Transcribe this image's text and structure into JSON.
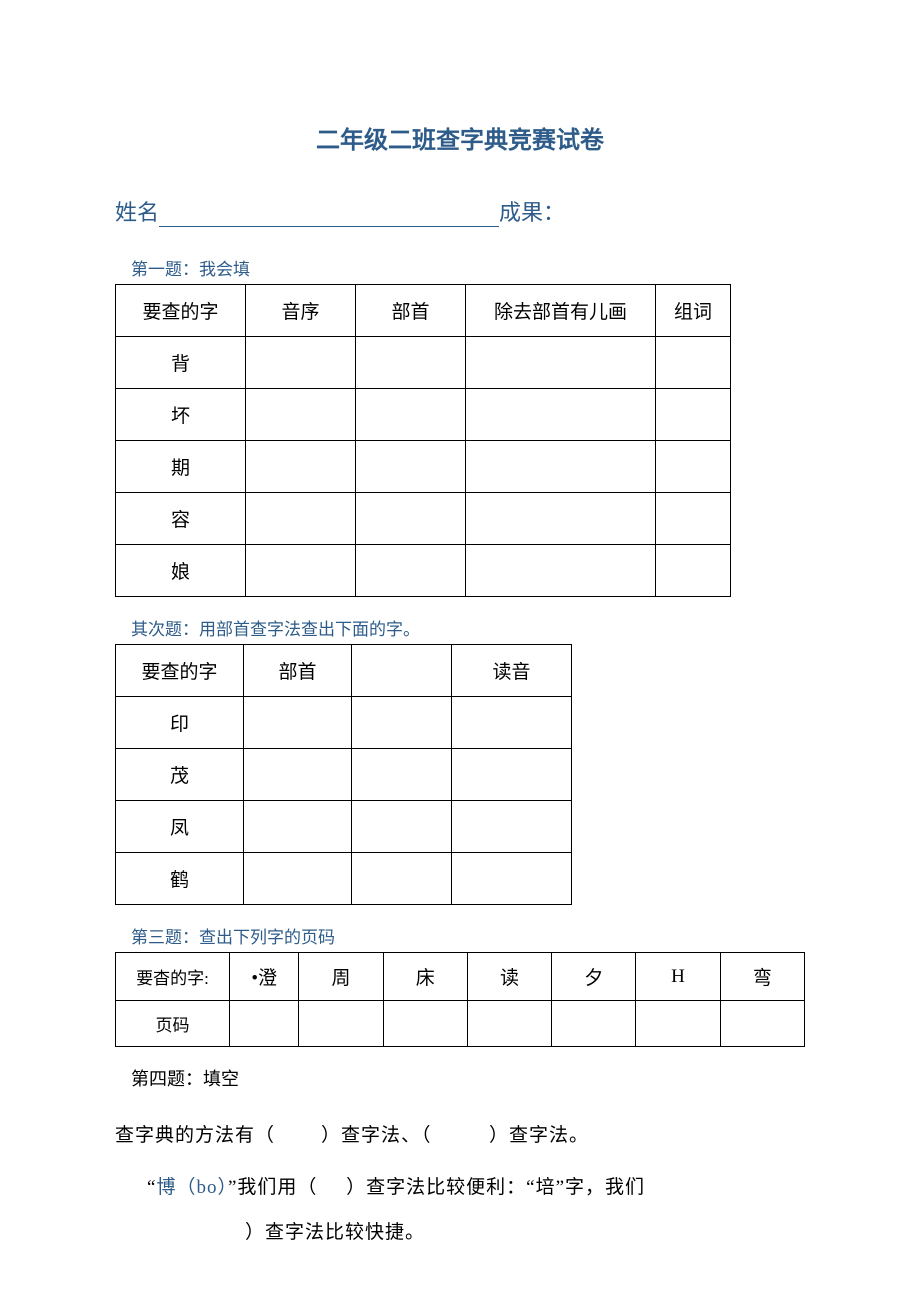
{
  "title": "二年级二班查字典竞赛试卷",
  "name_label": "姓名",
  "result_label": "成果：",
  "q1": {
    "heading": "第一题：我会填",
    "headers": [
      "要查的字",
      "音序",
      "部首",
      "除去部首有儿画",
      "组词"
    ],
    "rows": [
      "背",
      "坏",
      "期",
      "容",
      "娘"
    ]
  },
  "q2": {
    "heading": "其次题：用部首查字法查出下面的字。",
    "headers": [
      "要查的字",
      "部首",
      "",
      "读音"
    ],
    "rows": [
      "印",
      "茂",
      "凤",
      "鹤"
    ]
  },
  "q3": {
    "heading": "第三题：查出下列字的页码",
    "row1_label": "要杳的字:",
    "row1_cells": [
      "•澄",
      "周",
      "床",
      "读",
      "夕",
      "H",
      "弯"
    ],
    "row2_label": "页码"
  },
  "q4": {
    "heading": "第四题：填空",
    "line1_a": "查字典的方法有（",
    "line1_b": "）查字法、（",
    "line1_c": "）查字法。",
    "line2_a": "“",
    "line2_b": "博（bo）",
    "line2_c": "”我们用（",
    "line2_d": "）查字法比较便利：“培”字，我们",
    "line3": "）查字法比较快捷。"
  }
}
